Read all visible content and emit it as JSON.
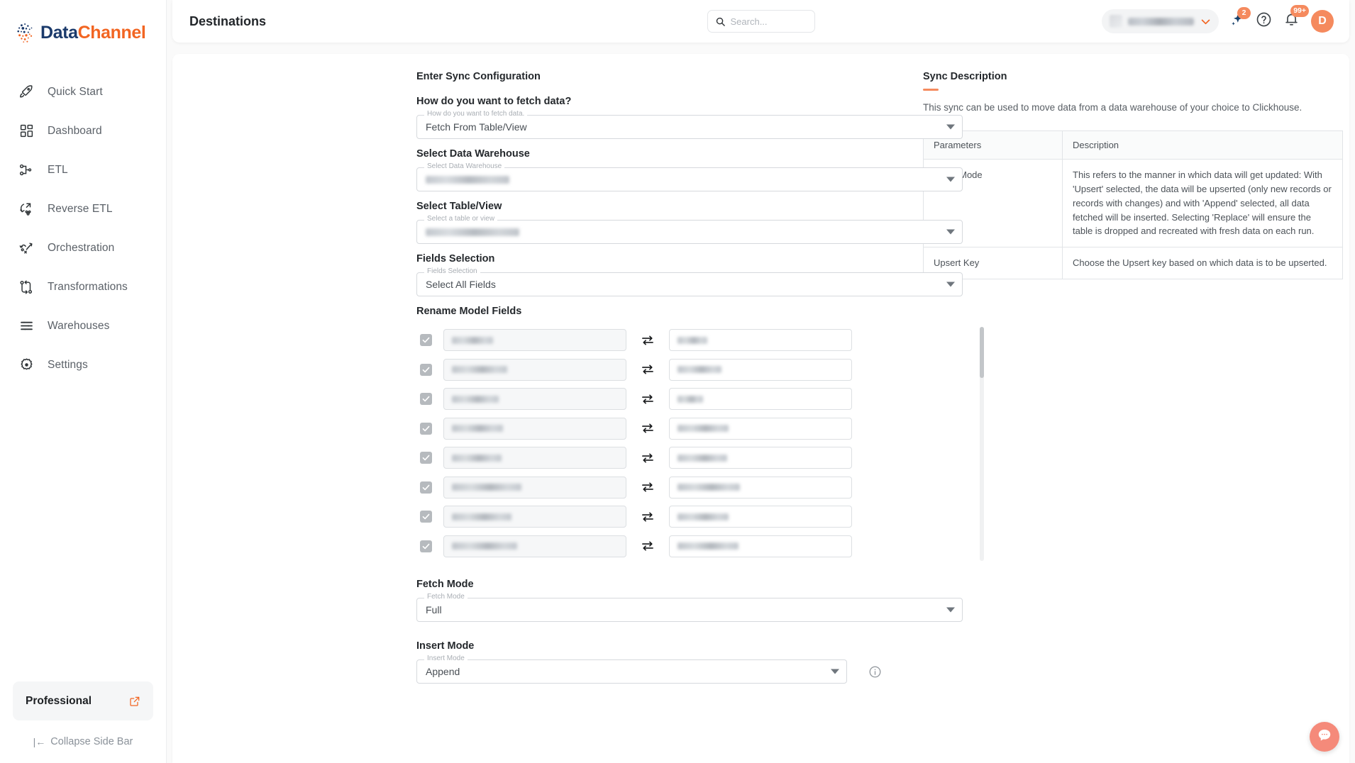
{
  "brand": {
    "name_part1": "Data",
    "name_part2": "Channel",
    "accent": "#f26522",
    "coral": "#f58a5e",
    "navy": "#1b3a6b"
  },
  "sidebar": {
    "items": [
      {
        "label": "Quick Start",
        "icon": "rocket-icon"
      },
      {
        "label": "Dashboard",
        "icon": "grid-icon"
      },
      {
        "label": "ETL",
        "icon": "etl-icon"
      },
      {
        "label": "Reverse ETL",
        "icon": "reverse-etl-icon"
      },
      {
        "label": "Orchestration",
        "icon": "orchestration-icon"
      },
      {
        "label": "Transformations",
        "icon": "transformations-icon"
      },
      {
        "label": "Warehouses",
        "icon": "warehouses-icon"
      },
      {
        "label": "Settings",
        "icon": "gear-icon"
      }
    ],
    "plan": {
      "label": "Professional",
      "icon": "external-link-icon"
    },
    "collapse": {
      "glyph": "|←",
      "label": "Collapse Side Bar"
    }
  },
  "header": {
    "title": "Destinations",
    "search": {
      "placeholder": "Search...",
      "icon": "search-icon"
    },
    "workspace": {
      "value": "",
      "chevron_icon": "chevron-down-icon"
    },
    "sparkle": {
      "icon": "sparkle-icon",
      "badge": "2"
    },
    "help": {
      "icon": "help-circle-icon"
    },
    "notifications": {
      "icon": "bell-icon",
      "badge": "99+"
    },
    "avatar": {
      "initial": "D"
    }
  },
  "form": {
    "section_title": "Enter Sync Configuration",
    "fetch_data": {
      "heading": "How do you want to fetch data?",
      "floating_label": "How do you want to fetch data.",
      "value": "Fetch From Table/View"
    },
    "data_warehouse": {
      "heading": "Select Data Warehouse",
      "floating_label": "Select Data Warehouse",
      "value": ""
    },
    "table_view": {
      "heading": "Select Table/View",
      "floating_label": "Select a table or view",
      "value": ""
    },
    "fields_selection": {
      "heading": "Fields Selection",
      "floating_label": "Fields Selection",
      "value": "Select All Fields"
    },
    "rename_model_fields": {
      "heading": "Rename Model Fields",
      "swap_icon": "swap-arrows-icon",
      "rows": [
        {
          "checked": true,
          "source": "",
          "target": "",
          "source_w": 58,
          "target_w": 42
        },
        {
          "checked": true,
          "source": "",
          "target": "",
          "source_w": 78,
          "target_w": 62
        },
        {
          "checked": true,
          "source": "",
          "target": "",
          "source_w": 66,
          "target_w": 36
        },
        {
          "checked": true,
          "source": "",
          "target": "",
          "source_w": 72,
          "target_w": 72
        },
        {
          "checked": true,
          "source": "",
          "target": "",
          "source_w": 70,
          "target_w": 70
        },
        {
          "checked": true,
          "source": "",
          "target": "",
          "source_w": 98,
          "target_w": 88
        },
        {
          "checked": true,
          "source": "",
          "target": "",
          "source_w": 84,
          "target_w": 72
        },
        {
          "checked": true,
          "source": "",
          "target": "",
          "source_w": 92,
          "target_w": 86
        }
      ]
    },
    "fetch_mode": {
      "heading": "Fetch Mode",
      "floating_label": "Fetch Mode",
      "value": "Full"
    },
    "insert_mode": {
      "heading": "Insert Mode",
      "floating_label": "Insert Mode",
      "value": "Append",
      "info_icon": "info-circle-icon"
    }
  },
  "sync_description": {
    "title": "Sync Description",
    "text": "This sync can be used to move data from a data warehouse of your choice to Clickhouse.",
    "table": {
      "headers": [
        "Parameters",
        "Description"
      ],
      "rows": [
        {
          "parameter": "Insert Mode",
          "description": "This refers to the manner in which data will get updated: With 'Upsert' selected, the data will be upserted (only new records or records with changes) and with 'Append' selected, all data fetched will be inserted. Selecting 'Replace' will ensure the table is dropped and recreated with fresh data on each run."
        },
        {
          "parameter": "Upsert Key",
          "description": "Choose the Upsert key based on which data is to be upserted."
        }
      ]
    }
  },
  "chat": {
    "icon": "chat-bubble-icon"
  }
}
